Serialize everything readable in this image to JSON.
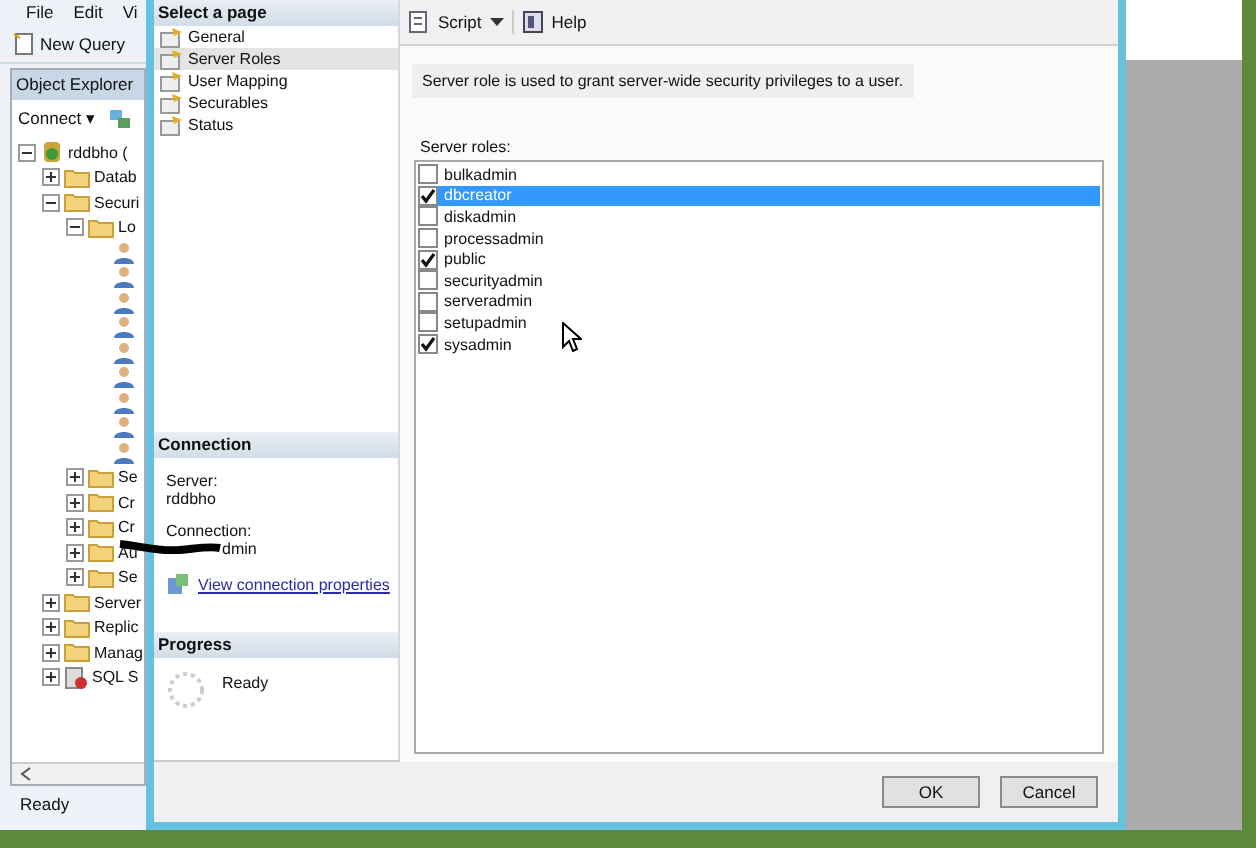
{
  "app": {
    "menu": [
      "File",
      "Edit",
      "Vi"
    ],
    "toolbar": {
      "new_query": "New Query"
    },
    "object_explorer": {
      "title": "Object Explorer",
      "connect": "Connect ▾",
      "tree": [
        {
          "kind": "server",
          "label": "rddbho (",
          "expanded": true,
          "children": [
            {
              "kind": "folder",
              "label": "Datab",
              "expanded": false
            },
            {
              "kind": "folder",
              "label": "Securi",
              "expanded": true,
              "children": [
                {
                  "kind": "folder",
                  "label": "Lo",
                  "expanded": true,
                  "children": [
                    {
                      "kind": "login"
                    },
                    {
                      "kind": "login"
                    },
                    {
                      "kind": "login"
                    },
                    {
                      "kind": "login"
                    },
                    {
                      "kind": "login"
                    },
                    {
                      "kind": "login"
                    },
                    {
                      "kind": "login"
                    },
                    {
                      "kind": "login"
                    },
                    {
                      "kind": "login"
                    }
                  ]
                },
                {
                  "kind": "folder",
                  "label": "Se",
                  "expanded": false
                },
                {
                  "kind": "folder",
                  "label": "Cr",
                  "expanded": false
                },
                {
                  "kind": "folder",
                  "label": "Cr",
                  "expanded": false
                },
                {
                  "kind": "folder",
                  "label": "Au",
                  "expanded": false
                },
                {
                  "kind": "folder",
                  "label": "Se",
                  "expanded": false
                }
              ]
            },
            {
              "kind": "folder",
              "label": "Server",
              "expanded": false
            },
            {
              "kind": "folder",
              "label": "Replic",
              "expanded": false
            },
            {
              "kind": "folder",
              "label": "Manag",
              "expanded": false
            },
            {
              "kind": "agent",
              "label": "SQL S",
              "expanded": false
            }
          ]
        }
      ]
    },
    "status_bar": "Ready"
  },
  "dialog": {
    "select_page": {
      "title": "Select a page",
      "items": [
        {
          "label": "General",
          "selected": false
        },
        {
          "label": "Server Roles",
          "selected": true
        },
        {
          "label": "User Mapping",
          "selected": false
        },
        {
          "label": "Securables",
          "selected": false
        },
        {
          "label": "Status",
          "selected": false
        }
      ]
    },
    "connection": {
      "title": "Connection",
      "server_label": "Server:",
      "server": "rddbho",
      "connection_label": "Connection:",
      "connection": "dmin",
      "link": "View connection properties"
    },
    "progress": {
      "title": "Progress",
      "status": "Ready"
    },
    "toolbar": {
      "script": "Script",
      "help": "Help"
    },
    "description": "Server role is used to grant server-wide security privileges to a user.",
    "roles_label": "Server roles:",
    "roles": [
      {
        "name": "bulkadmin",
        "checked": false,
        "selected": false
      },
      {
        "name": "dbcreator",
        "checked": true,
        "selected": true
      },
      {
        "name": "diskadmin",
        "checked": false,
        "selected": false
      },
      {
        "name": "processadmin",
        "checked": false,
        "selected": false
      },
      {
        "name": "public",
        "checked": true,
        "selected": false
      },
      {
        "name": "securityadmin",
        "checked": false,
        "selected": false
      },
      {
        "name": "serveradmin",
        "checked": false,
        "selected": false
      },
      {
        "name": "setupadmin",
        "checked": false,
        "selected": false
      },
      {
        "name": "sysadmin",
        "checked": true,
        "selected": false
      }
    ],
    "buttons": [
      "OK",
      "Cancel"
    ]
  }
}
